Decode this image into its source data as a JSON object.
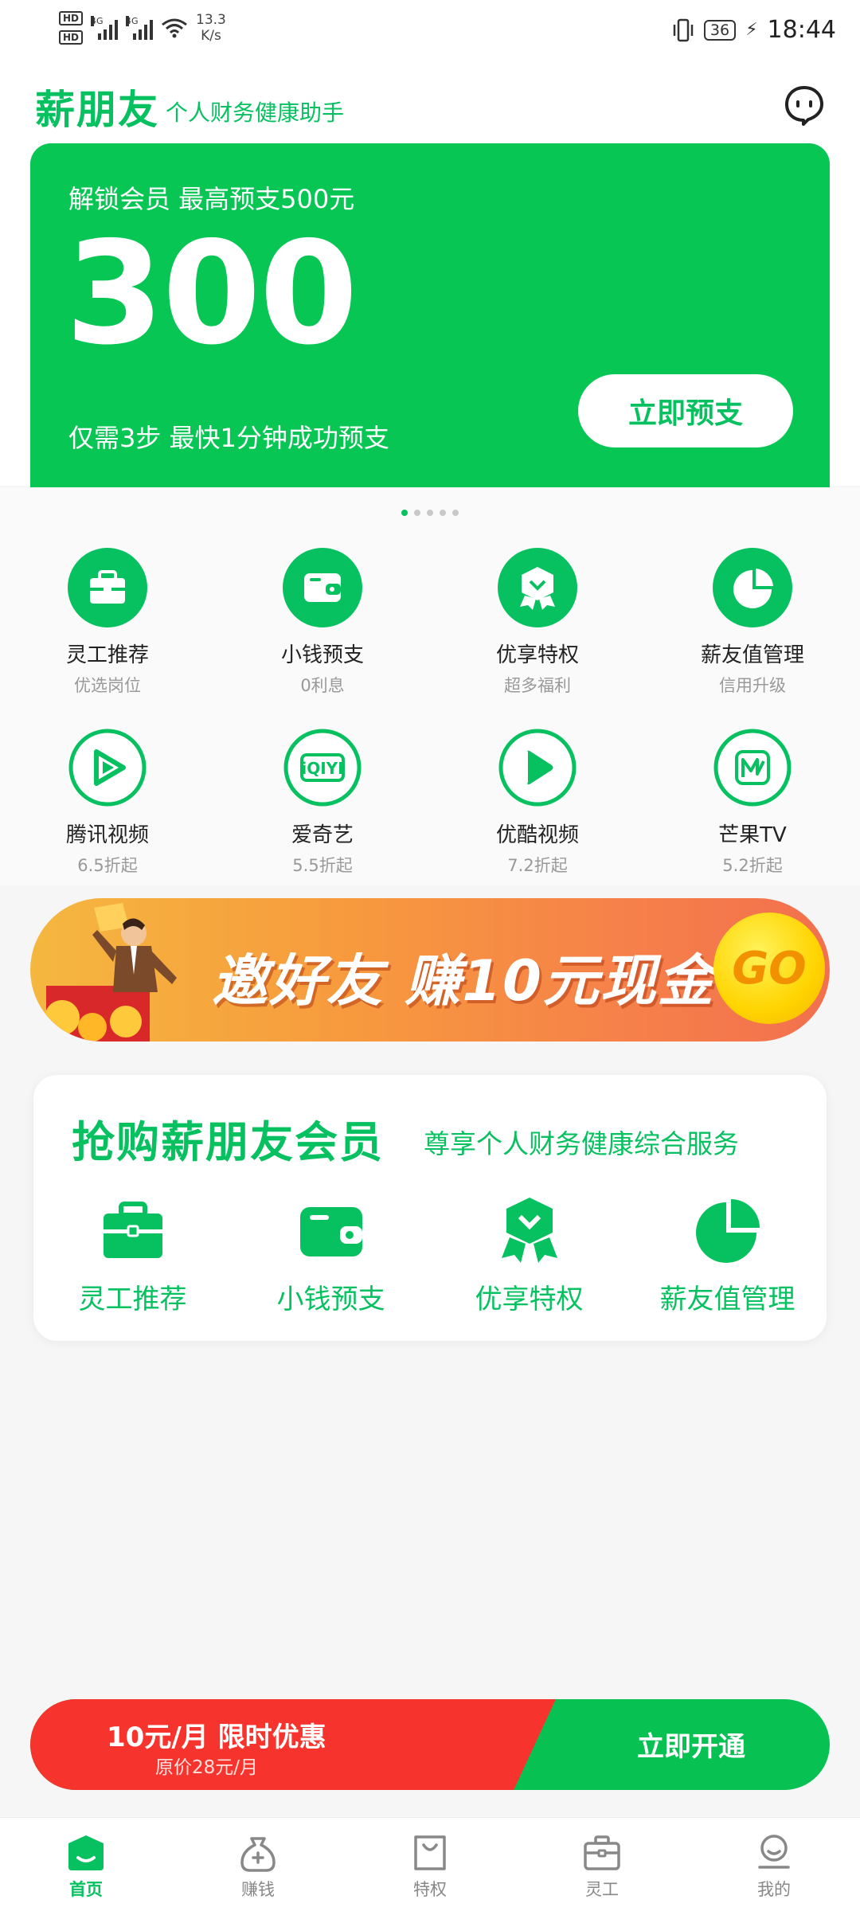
{
  "status_bar": {
    "hd1": "HD",
    "hd2": "HD",
    "net1": "4G",
    "net2": "4G",
    "speed_value": "13.3",
    "speed_unit": "K/s",
    "battery": "36",
    "time": "18:44"
  },
  "header": {
    "logo": "薪朋友",
    "slogan": "个人财务健康助手",
    "message_icon": "chat-bubble-icon"
  },
  "hero": {
    "subtitle": "解锁会员  最高预支500元",
    "amount": "300",
    "tip": "仅需3步  最快1分钟成功预支",
    "button": "立即预支",
    "color": "#07c653"
  },
  "pager": {
    "count": 5,
    "active": 0
  },
  "services": [
    {
      "title": "灵工推荐",
      "subtitle": "优选岗位",
      "icon": "briefcase-icon"
    },
    {
      "title": "小钱预支",
      "subtitle": "0利息",
      "icon": "wallet-icon"
    },
    {
      "title": "优享特权",
      "subtitle": "超多福利",
      "icon": "badge-icon"
    },
    {
      "title": "薪友值管理",
      "subtitle": "信用升级",
      "icon": "pie-chart-icon"
    },
    {
      "title": "腾讯视频",
      "subtitle": "6.5折起",
      "icon": "tencent-video-icon"
    },
    {
      "title": "爱奇艺",
      "subtitle": "5.5折起",
      "icon": "iqiyi-icon"
    },
    {
      "title": "优酷视频",
      "subtitle": "7.2折起",
      "icon": "youku-icon"
    },
    {
      "title": "芒果TV",
      "subtitle": "5.2折起",
      "icon": "mango-tv-icon"
    }
  ],
  "invite": {
    "text": "邀好友 赚10元现金",
    "go": "GO"
  },
  "membership": {
    "title": "抢购薪朋友会员",
    "subtitle": "尊享个人财务健康综合服务",
    "items": [
      {
        "label": "灵工推荐",
        "icon": "briefcase-icon"
      },
      {
        "label": "小钱预支",
        "icon": "wallet-icon"
      },
      {
        "label": "优享特权",
        "icon": "badge-icon"
      },
      {
        "label": "薪友值管理",
        "icon": "pie-chart-icon"
      }
    ]
  },
  "promo": {
    "price": "10元/月 限时优惠",
    "original": "原价28元/月",
    "button": "立即开通"
  },
  "tabbar": [
    {
      "label": "首页",
      "icon": "home-icon",
      "active": true
    },
    {
      "label": "赚钱",
      "icon": "money-bag-icon",
      "active": false
    },
    {
      "label": "特权",
      "icon": "shopping-bag-icon",
      "active": false
    },
    {
      "label": "灵工",
      "icon": "briefcase-icon",
      "active": false
    },
    {
      "label": "我的",
      "icon": "profile-icon",
      "active": false
    }
  ],
  "colors": {
    "brand_green": "#07c160",
    "promo_red": "#f6342d",
    "invite_orange": "#f79a3e"
  }
}
